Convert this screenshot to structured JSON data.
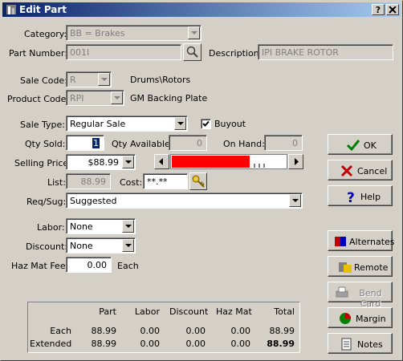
{
  "window": {
    "title": "Edit Part",
    "help_button": "?",
    "close_button": "X"
  },
  "form": {
    "category": {
      "label": "Category:",
      "value": "BB =  Brakes"
    },
    "part_number": {
      "label": "Part Number:",
      "value": "001I"
    },
    "description": {
      "label": "Description:",
      "value": "IPI BRAKE ROTOR"
    },
    "sale_code": {
      "label": "Sale Code:",
      "value": "R",
      "desc": "Drums\\Rotors"
    },
    "product_code": {
      "label": "Product Code:",
      "value": "RPI",
      "desc": "GM Backing Plate"
    },
    "sale_type": {
      "label": "Sale Type:",
      "value": "Regular Sale"
    },
    "buyout": {
      "label": "Buyout",
      "checked": true
    },
    "qty_sold": {
      "label": "Qty Sold:",
      "value": "1"
    },
    "qty_available": {
      "label": "Qty Available:",
      "value": "0"
    },
    "on_hand": {
      "label": "On Hand:",
      "value": "0"
    },
    "selling_price": {
      "label": "Selling Price:",
      "value": "$88.99"
    },
    "list": {
      "label": "List:",
      "value": "88.99"
    },
    "cost": {
      "label": "Cost:",
      "value": "**.**"
    },
    "req_sug": {
      "label": "Req/Sug:",
      "value": "Suggested"
    },
    "labor": {
      "label": "Labor:",
      "value": "None"
    },
    "discount": {
      "label": "Discount:",
      "value": "None"
    },
    "haz_mat_fee": {
      "label": "Haz Mat Fee:",
      "value": "0.00",
      "suffix": "Each"
    },
    "margin_gauge": {
      "fill_fraction": 0.68,
      "color": "#ff0000"
    }
  },
  "buttons": {
    "ok": "OK",
    "cancel": "Cancel",
    "help": "Help",
    "alternates": "Alternates",
    "remote": "Remote",
    "bend_card": "Bend Card",
    "margin": "Margin",
    "notes": "Notes"
  },
  "summary": {
    "headers": [
      "Part",
      "Labor",
      "Discount",
      "Haz Mat",
      "Total"
    ],
    "rows": [
      {
        "label": "Each",
        "values": [
          "88.99",
          "0.00",
          "0.00",
          "0.00",
          "88.99"
        ]
      },
      {
        "label": "Extended",
        "values": [
          "88.99",
          "0.00",
          "0.00",
          "0.00",
          "88.99"
        ]
      }
    ]
  },
  "colors": {
    "title_start": "#0a246a",
    "title_end": "#a6caf0",
    "face": "#d4d0c8",
    "ok_check": "#008000",
    "cancel_x": "#c00000",
    "help_q": "#0000c0"
  }
}
